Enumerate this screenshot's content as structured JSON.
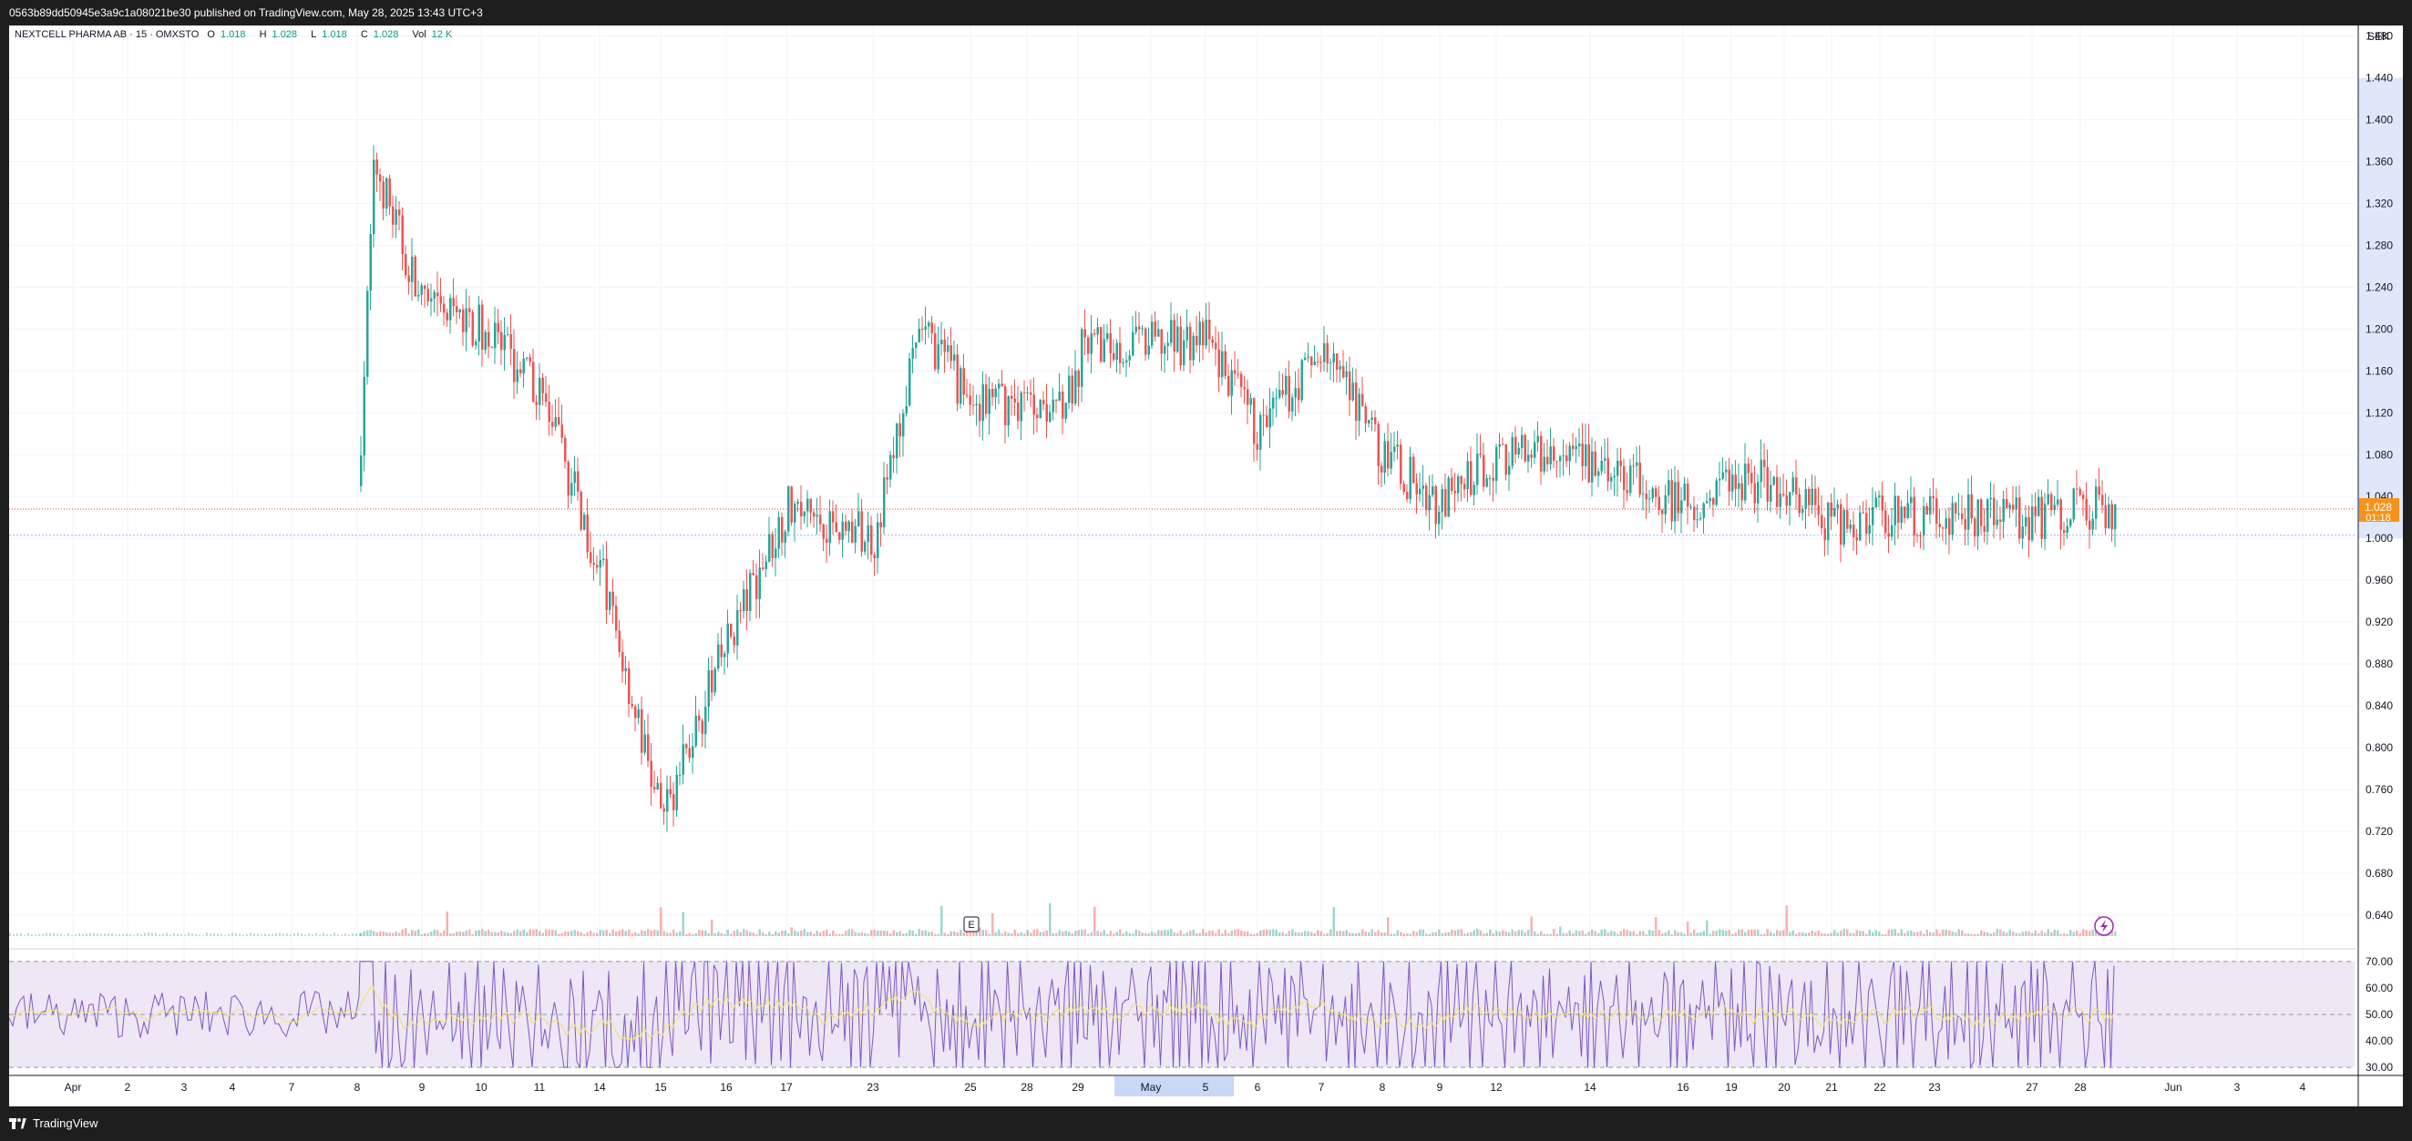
{
  "header": {
    "text": "0563b89dd50945e3a9c1a08021be30 published on TradingView.com, May 28, 2025 13:43 UTC+3"
  },
  "legend": {
    "symbol": "NEXTCELL PHARMA AB · 15 · OMXSTO",
    "open_label": "O",
    "open": "1.018",
    "high_label": "H",
    "high": "1.028",
    "low_label": "L",
    "low": "1.018",
    "close_label": "C",
    "close": "1.028",
    "vol_label": "Vol",
    "vol": "12 K"
  },
  "price_axis": {
    "currency": "SEK",
    "ticks": [
      "1.480",
      "1.440",
      "1.400",
      "1.360",
      "1.320",
      "1.280",
      "1.240",
      "1.200",
      "1.160",
      "1.120",
      "1.080",
      "1.040",
      "1.000",
      "0.960",
      "0.920",
      "0.880",
      "0.840",
      "0.800",
      "0.760",
      "0.720",
      "0.680",
      "0.640"
    ],
    "last_price": "1.028",
    "countdown": "01:18"
  },
  "rsi_axis": {
    "ticks": [
      "70.00",
      "60.00",
      "50.00",
      "40.00",
      "30.00"
    ]
  },
  "time_axis": {
    "ticks": [
      "Apr",
      "2",
      "3",
      "4",
      "7",
      "8",
      "9",
      "10",
      "11",
      "14",
      "15",
      "16",
      "17",
      "23",
      "25",
      "28",
      "29",
      "May",
      "5",
      "6",
      "7",
      "8",
      "9",
      "12",
      "14",
      "16",
      "19",
      "20",
      "21",
      "22",
      "23",
      "27",
      "28",
      "Jun",
      "3",
      "4"
    ],
    "highlighted": "May"
  },
  "markers": {
    "earnings": "E"
  },
  "footer": {
    "brand": "TradingView"
  },
  "colors": {
    "up": "#26a69a",
    "down": "#ef5350",
    "rsi_line": "#7e57c2",
    "rsi_ma": "#f5e05b",
    "rsi_band": "#ede7f6",
    "last_price_bg": "#f7931a",
    "price_line": "#f23645",
    "range_highlight": "#c9d8f7"
  },
  "chart_data": {
    "type": "candlestick",
    "symbol": "NEXTCELL PHARMA AB",
    "interval": "15",
    "exchange": "OMXSTO",
    "currency": "SEK",
    "ylim": [
      0.62,
      1.49
    ],
    "last_price": 1.028,
    "approx_close_path": [
      {
        "x": "Apr 8",
        "y": 1.05
      },
      {
        "x": "Apr 8",
        "y": 1.36
      },
      {
        "x": "Apr 9",
        "y": 1.22
      },
      {
        "x": "Apr 10",
        "y": 1.2
      },
      {
        "x": "Apr 11",
        "y": 1.14
      },
      {
        "x": "Apr 14",
        "y": 0.97
      },
      {
        "x": "Apr 15",
        "y": 0.73
      },
      {
        "x": "Apr 16",
        "y": 0.9
      },
      {
        "x": "Apr 17",
        "y": 1.03
      },
      {
        "x": "Apr 23",
        "y": 1.0
      },
      {
        "x": "Apr 24",
        "y": 1.2
      },
      {
        "x": "Apr 25",
        "y": 1.13
      },
      {
        "x": "Apr 28",
        "y": 1.13
      },
      {
        "x": "Apr 29",
        "y": 1.14
      },
      {
        "x": "May 2",
        "y": 1.1
      },
      {
        "x": "May 5",
        "y": 1.19
      },
      {
        "x": "May 6",
        "y": 1.1
      },
      {
        "x": "May 7",
        "y": 1.18
      },
      {
        "x": "May 8",
        "y": 1.08
      },
      {
        "x": "May 9",
        "y": 1.03
      },
      {
        "x": "May 12",
        "y": 1.08
      },
      {
        "x": "May 14",
        "y": 1.07
      },
      {
        "x": "May 16",
        "y": 1.03
      },
      {
        "x": "May 19",
        "y": 1.06
      },
      {
        "x": "May 20",
        "y": 1.05
      },
      {
        "x": "May 21",
        "y": 1.01
      },
      {
        "x": "May 22",
        "y": 1.02
      },
      {
        "x": "May 23",
        "y": 1.02
      },
      {
        "x": "May 27",
        "y": 1.02
      },
      {
        "x": "May 28",
        "y": 1.028
      }
    ],
    "notable_highs": [
      1.41,
      1.44,
      1.355,
      1.19
    ],
    "notable_low": 0.69,
    "rsi": {
      "levels": [
        70,
        50,
        30
      ],
      "ylim": [
        28,
        72
      ]
    }
  }
}
